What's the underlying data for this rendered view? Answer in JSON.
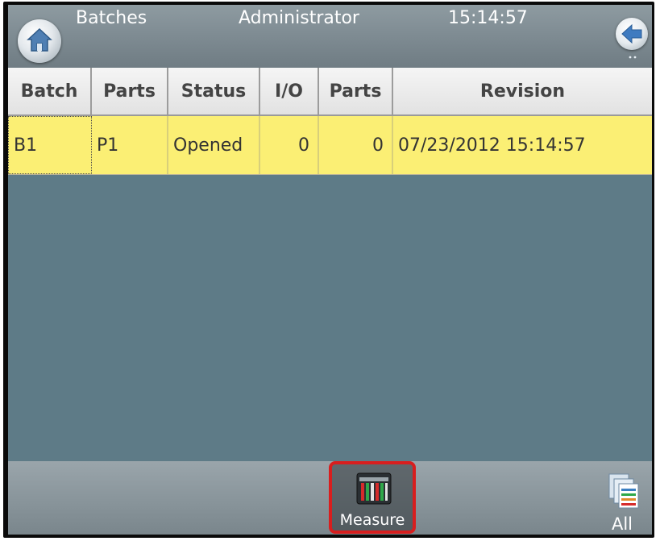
{
  "header": {
    "title": "Batches",
    "user": "Administrator",
    "time": "15:14:57",
    "home_icon": "home-icon",
    "back_icon": "back-arrow-icon"
  },
  "table": {
    "columns": [
      "Batch",
      "Parts",
      "Status",
      "I/O",
      "Parts",
      "Revision"
    ],
    "rows": [
      {
        "batch": "B1",
        "parts": "P1",
        "status": "Opened",
        "io": "0",
        "parts_count": "0",
        "revision": "07/23/2012 15:14:57"
      }
    ]
  },
  "footer": {
    "measure_label": "Measure",
    "all_label": "All",
    "measure_icon": "measure-icon",
    "all_icon": "all-documents-icon"
  },
  "colors": {
    "header_bg": "#7e8b92",
    "grid_bg": "#5e7b87",
    "selected_row": "#fbef74",
    "highlight_border": "#d81e1e"
  }
}
